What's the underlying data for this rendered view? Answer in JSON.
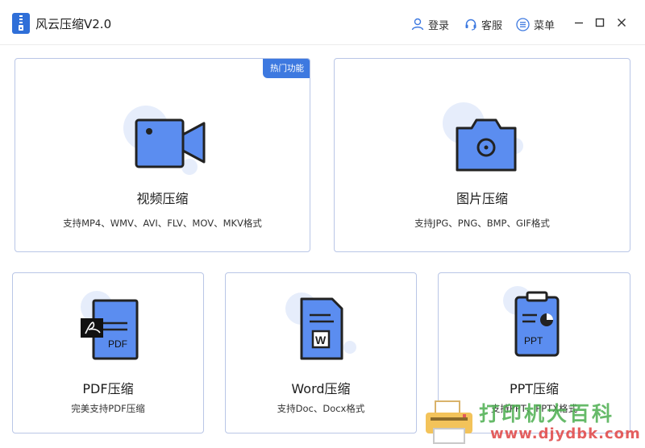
{
  "app": {
    "title": "风云压缩V2.0",
    "accent": "#3d79e0",
    "icon_fill": "#5b8df0"
  },
  "header": {
    "login_label": "登录",
    "service_label": "客服",
    "menu_label": "菜单"
  },
  "window_controls": [
    "minimize-icon",
    "maximize-icon",
    "close-icon"
  ],
  "cards": [
    {
      "id": "video",
      "title": "视频压缩",
      "desc": "支持MP4、WMV、AVI、FLV、MOV、MKV格式",
      "badge": "热门功能",
      "icon": "video-camera-icon"
    },
    {
      "id": "image",
      "title": "图片压缩",
      "desc": "支持JPG、PNG、BMP、GIF格式",
      "icon": "photo-camera-icon"
    },
    {
      "id": "pdf",
      "title": "PDF压缩",
      "desc": "完美支持PDF压缩",
      "icon": "pdf-file-icon",
      "icon_text": "PDF"
    },
    {
      "id": "word",
      "title": "Word压缩",
      "desc": "支持Doc、Docx格式",
      "icon": "word-file-icon",
      "icon_text": "W"
    },
    {
      "id": "ppt",
      "title": "PPT压缩",
      "desc": "支持PPT、PPTX格式",
      "icon": "ppt-clipboard-icon",
      "icon_text": "PPT"
    }
  ],
  "watermark": {
    "text": "打印机大百科",
    "url": "www.djydbk.com"
  }
}
